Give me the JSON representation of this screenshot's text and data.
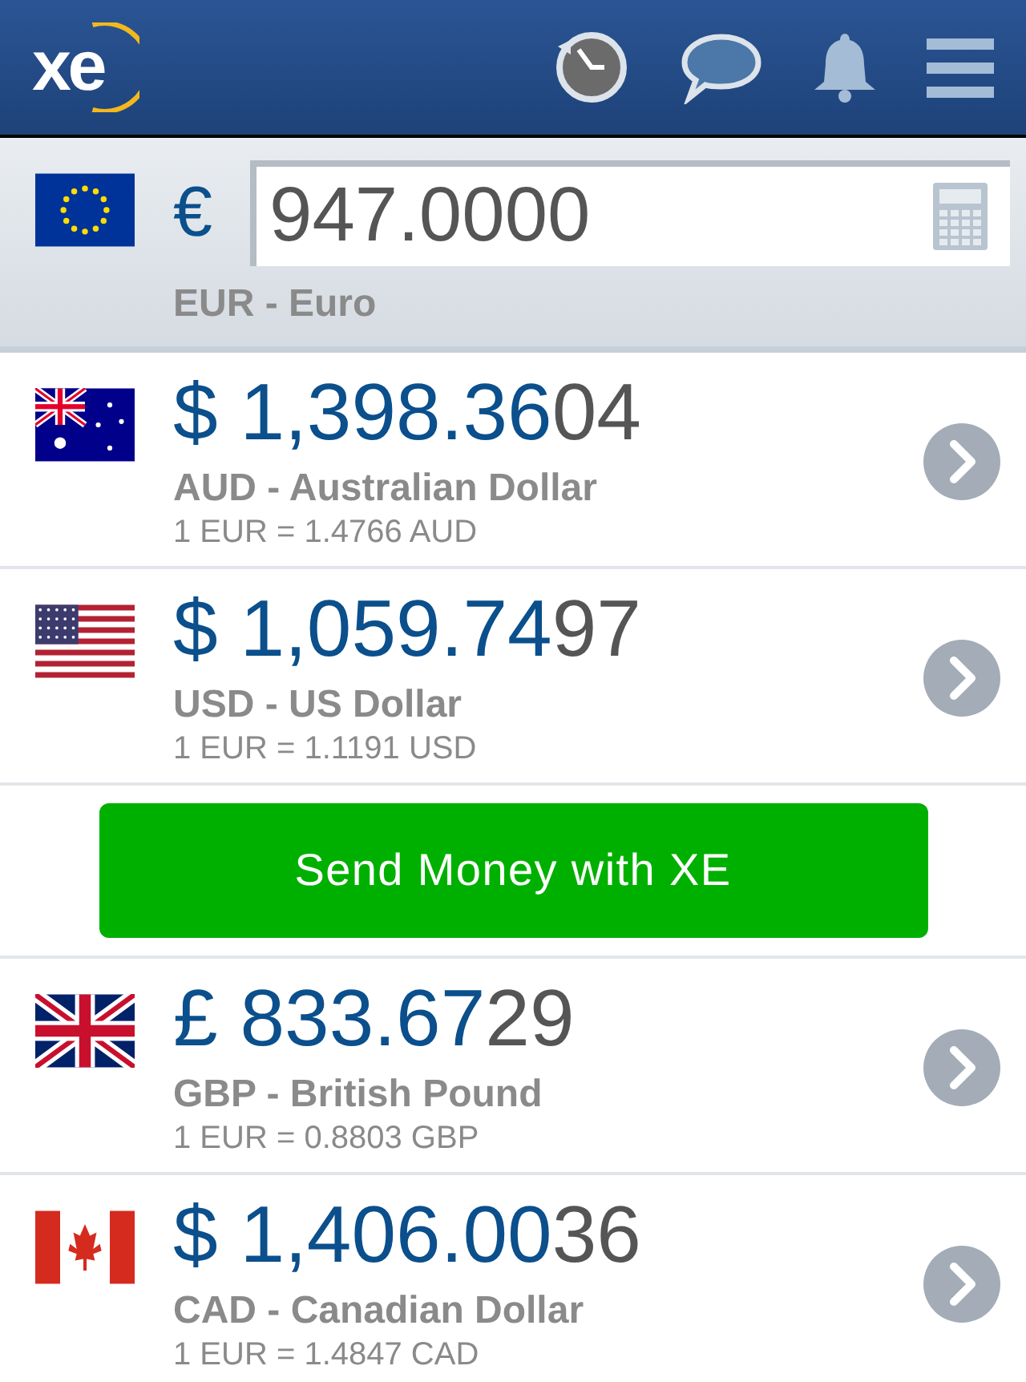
{
  "header": {
    "logo": "xe"
  },
  "base": {
    "symbol": "€",
    "amount": "947.0000",
    "name": "EUR - Euro"
  },
  "rows": [
    {
      "kind": "currency",
      "amount_main": "$ 1,398.36",
      "amount_extra": "04",
      "name": "AUD - Australian Dollar",
      "rate": "1 EUR = 1.4766 AUD"
    },
    {
      "kind": "currency",
      "amount_main": "$ 1,059.74",
      "amount_extra": "97",
      "name": "USD - US Dollar",
      "rate": "1 EUR = 1.1191 USD"
    },
    {
      "kind": "promo",
      "label": "Send Money with XE"
    },
    {
      "kind": "currency",
      "amount_main": "£ 833.67",
      "amount_extra": "29",
      "name": "GBP - British Pound",
      "rate": "1 EUR = 0.8803 GBP"
    },
    {
      "kind": "currency",
      "amount_main": "$ 1,406.00",
      "amount_extra": "36",
      "name": "CAD - Canadian Dollar",
      "rate": "1 EUR = 1.4847 CAD"
    }
  ]
}
